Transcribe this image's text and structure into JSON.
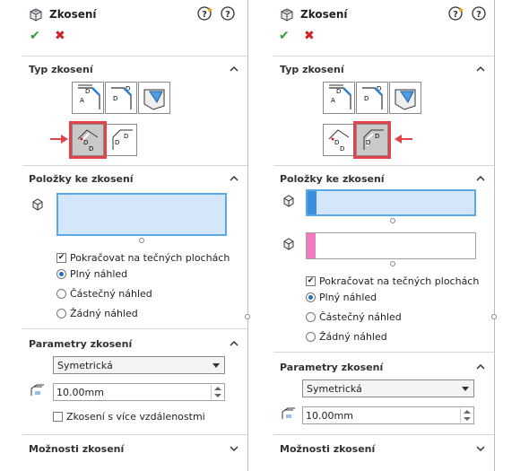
{
  "left": {
    "title": "Zkosení",
    "sections": {
      "type": "Typ zkosení",
      "items": "Položky ke zkosení",
      "params": "Parametry zkosení",
      "options": "Možnosti zkosení"
    },
    "tangent_label": "Pokračovat na tečných plochách",
    "preview_full": "Plný náhled",
    "preview_partial": "Částečný náhled",
    "preview_none": "Žádný náhled",
    "mode": "Symetrická",
    "distance": "10.00mm",
    "multi_label": "Zkosení s více vzdálenostmi"
  },
  "right": {
    "title": "Zkosení",
    "sections": {
      "type": "Typ zkosení",
      "items": "Položky ke zkosení",
      "params": "Parametry zkosení",
      "options": "Možnosti zkosení"
    },
    "tangent_label": "Pokračovat na tečných plochách",
    "preview_full": "Plný náhled",
    "preview_partial": "Částečný náhled",
    "preview_none": "Žádný náhled",
    "mode": "Symetrická",
    "distance": "10.00mm"
  },
  "colors": {
    "accent_blue": "#5aa8e6",
    "highlight_red": "#e0444a",
    "ok_green": "#2e9e2e",
    "cancel_red": "#d0202a",
    "face_pink": "#f07ac0"
  }
}
